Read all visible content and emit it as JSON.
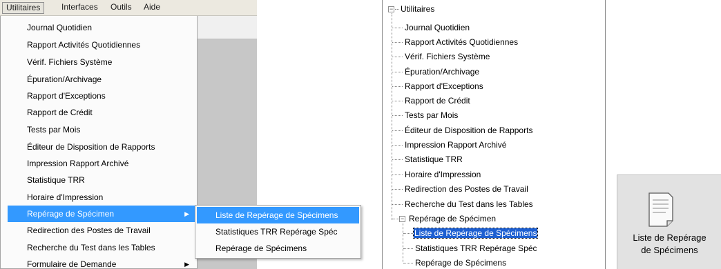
{
  "menubar": {
    "items": [
      "Utilitaires",
      "Interfaces",
      "Outils",
      "Aide"
    ]
  },
  "menu": {
    "items": [
      {
        "label": "Journal Quotidien"
      },
      {
        "label": "Rapport Activités Quotidiennes"
      },
      {
        "label": "Vérif. Fichiers Système"
      },
      {
        "label": "Épuration/Archivage"
      },
      {
        "label": "Rapport d'Exceptions"
      },
      {
        "label": "Rapport de Crédit"
      },
      {
        "label": "Tests par Mois"
      },
      {
        "label": "Éditeur de Disposition de Rapports"
      },
      {
        "label": "Impression Rapport Archivé"
      },
      {
        "label": "Statistique TRR"
      },
      {
        "label": "Horaire d'Impression"
      },
      {
        "label": "Repérage de Spécimen",
        "highlighted": true,
        "submenu": true
      },
      {
        "label": "Redirection des Postes de Travail"
      },
      {
        "label": "Recherche du Test dans les Tables"
      },
      {
        "label": "Formulaire de Demande",
        "submenu": true
      }
    ],
    "submenu": [
      {
        "label": "Liste de Repérage de Spécimens",
        "highlighted": true
      },
      {
        "label": "Statistiques TRR Repérage Spéc"
      },
      {
        "label": "Repérage de Spécimens"
      }
    ]
  },
  "tree": {
    "root": "Utilitaires",
    "children": [
      "Journal Quotidien",
      "Rapport Activités Quotidiennes",
      "Vérif. Fichiers Système",
      "Épuration/Archivage",
      "Rapport d'Exceptions",
      "Rapport de Crédit",
      "Tests par Mois",
      "Éditeur de Disposition de Rapports",
      "Impression Rapport Archivé",
      "Statistique TRR",
      "Horaire d'Impression",
      "Redirection des Postes de Travail",
      "Recherche du Test dans les Tables"
    ],
    "group": {
      "label": "Repérage de Spécimen",
      "children": [
        {
          "label": "Liste de Repérage de Spécimens",
          "selected": true
        },
        {
          "label": "Statistiques TRR Repérage Spéc"
        },
        {
          "label": "Repérage de Spécimens"
        }
      ]
    }
  },
  "tile": {
    "line1": "Liste de Repérage",
    "line2": "de Spécimens",
    "icon": "document-icon"
  },
  "colors": {
    "highlight": "#3399ff",
    "tree_selection": "#1d5fd1",
    "menubar": "#ece9e0",
    "tile": "#e2e2e2"
  }
}
